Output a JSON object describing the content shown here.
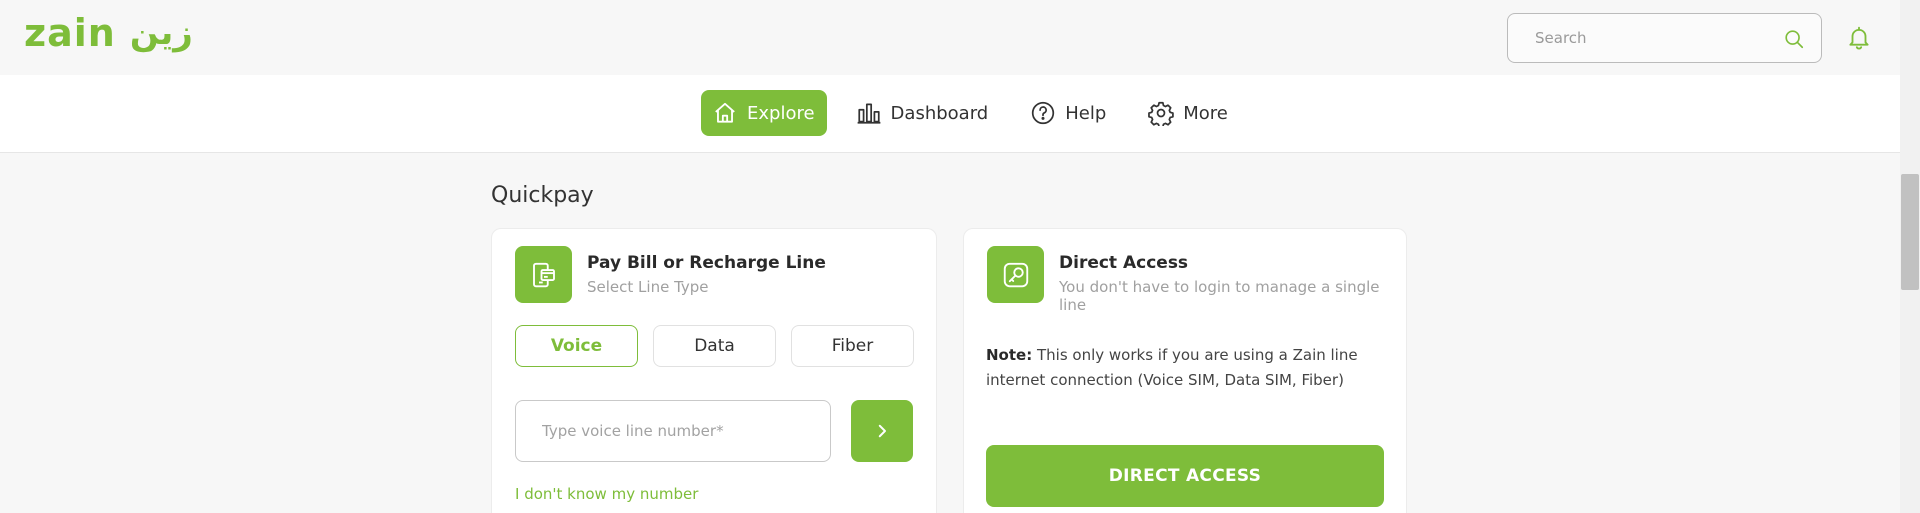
{
  "header": {
    "logo_latin": "zain",
    "logo_arabic": "زين",
    "search_placeholder": "Search",
    "icons": [
      "search-icon",
      "bell-icon"
    ]
  },
  "nav": {
    "items": [
      {
        "label": "Explore",
        "icon": "home-icon",
        "active": true
      },
      {
        "label": "Dashboard",
        "icon": "bar-chart-icon",
        "active": false
      },
      {
        "label": "Help",
        "icon": "question-icon",
        "active": false
      },
      {
        "label": "More",
        "icon": "gear-icon",
        "active": false
      }
    ]
  },
  "quickpay": {
    "title": "Quickpay",
    "pay_card": {
      "icon": "bill-icon",
      "title": "Pay Bill or Recharge Line",
      "subtitle": "Select Line Type",
      "line_types": [
        {
          "label": "Voice",
          "selected": true
        },
        {
          "label": "Data",
          "selected": false
        },
        {
          "label": "Fiber",
          "selected": false
        }
      ],
      "input_placeholder": "Type voice line number*",
      "submit_icon": "chevron-right-icon",
      "dont_know_link": "I don't know my number"
    },
    "direct_card": {
      "icon": "key-icon",
      "title": "Direct Access",
      "subtitle": "You don't have to login to manage a single line",
      "note_label": "Note:",
      "note_text": "This only works if you are using a Zain line internet connection (Voice SIM, Data SIM, Fiber)",
      "button_label": "DIRECT ACCESS"
    }
  },
  "colors": {
    "accent": "#7ebd3a",
    "background": "#f7f7f7",
    "card": "#ffffff"
  }
}
